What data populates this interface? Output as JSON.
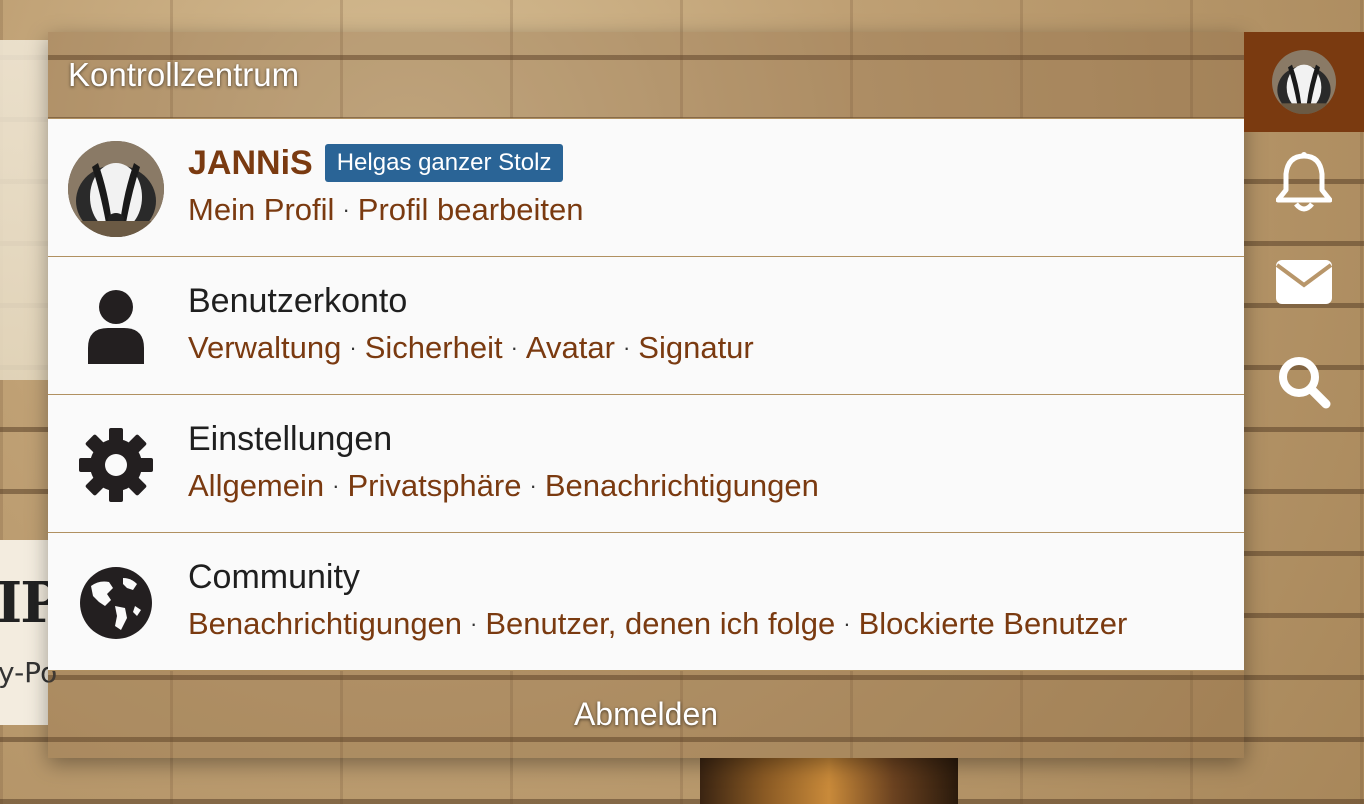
{
  "panel": {
    "title": "Kontrollzentrum",
    "logout_label": "Abmelden"
  },
  "user": {
    "name": "JANNiS",
    "rank_badge": "Helgas ganzer Stolz",
    "links": [
      "Mein Profil",
      "Profil bearbeiten"
    ]
  },
  "sections": [
    {
      "title": "Benutzerkonto",
      "icon": "user-icon",
      "links": [
        "Verwaltung",
        "Sicherheit",
        "Avatar",
        "Signatur"
      ]
    },
    {
      "title": "Einstellungen",
      "icon": "gear-icon",
      "links": [
        "Allgemein",
        "Privatsphäre",
        "Benachrichtigungen"
      ]
    },
    {
      "title": "Community",
      "icon": "globe-icon",
      "links": [
        "Benachrichtigungen",
        "Benutzer, denen ich folge",
        "Blockierte Benutzer"
      ]
    }
  ],
  "side_icons": [
    "user-avatar",
    "bell-icon",
    "envelope-icon",
    "search-icon"
  ],
  "background": {
    "heading_fragment": "IP",
    "sub_fragment": "y-Po"
  },
  "colors": {
    "link": "#7a3a10",
    "badge": "#2a6496",
    "active_side": "#7a3a10"
  }
}
